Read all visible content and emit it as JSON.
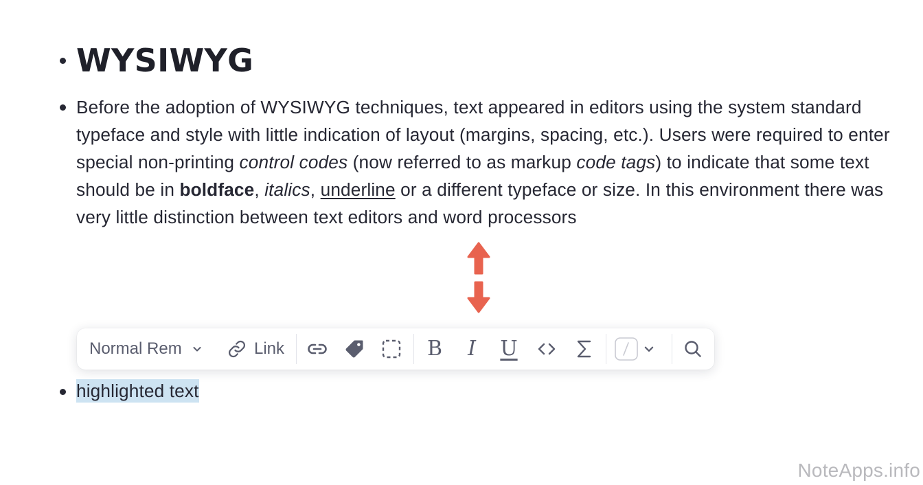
{
  "document": {
    "heading": "WYSIWYG",
    "paragraph": {
      "t1": "Before the adoption of WYSIWYG techniques, text appeared in editors using the system standard typeface and style with little indication of layout (margins, spacing, etc.). Users were required to enter special non-printing ",
      "italic1": "control codes",
      "t2": " (now referred to as markup ",
      "italic2": "code tags",
      "t3": ") to indicate that some text should be in ",
      "bold1": "boldface",
      "t4": ", ",
      "italic3": "italics",
      "t5": ", ",
      "underline1": "underline",
      "t6": " or a different typeface or size. In this environment there was very little distinction between text editors and word processors"
    },
    "highlighted_item": "highlighted text"
  },
  "toolbar": {
    "style_select_label": "Normal Rem",
    "link_button_label": "Link",
    "bold_label": "B",
    "italic_label": "I",
    "underline_label": "U",
    "code_label": "<>",
    "sum_label": "Σ",
    "icons": [
      "chevron-down-icon",
      "link-icon",
      "internal-link-icon",
      "tag-icon",
      "selection-box-icon",
      "code-icon",
      "sum-icon",
      "color-swatch-icon",
      "search-icon"
    ]
  },
  "annotation": {
    "arrow_color": "#e8634f"
  },
  "colors": {
    "highlight": "#cde3f2",
    "text": "#262733",
    "icon": "#5a5d6e"
  },
  "watermark": "NoteApps.info"
}
